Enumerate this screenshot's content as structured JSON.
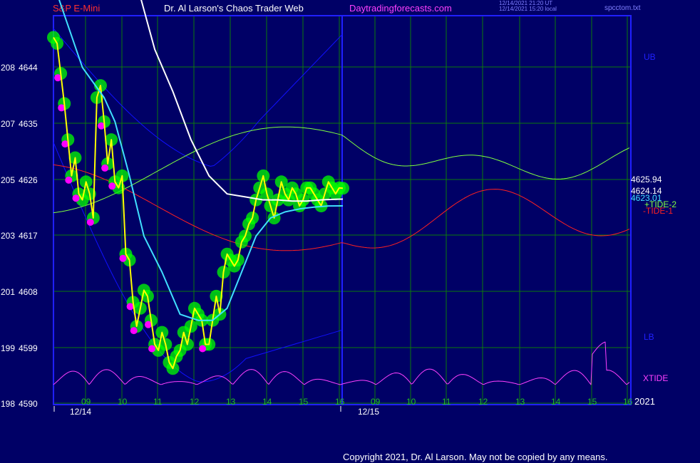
{
  "header": {
    "instrument": "S&P E-Mini",
    "title": "Dr. Al Larson's Chaos Trader Web",
    "site": "Daytradingforecasts.com",
    "timestamp_1": "12/14/2021 21:20 UT",
    "timestamp_2": "12/14/2021 15:20 local",
    "file": "spcctom.txt"
  },
  "copyright": "Copyright 2021, Dr. Al Larson. May not be copied by any means.",
  "colors": {
    "background": "#000066",
    "grid": "#0c7a0c",
    "frame": "#2020ff",
    "price": "#ffff00",
    "price_dots": "#00ff00",
    "extreme_dots": "#ff00ff",
    "average_cyan": "#40e0ff",
    "average_white": "#ffffff",
    "tide_plus": "#80ff40",
    "tide_minus": "#ff2020",
    "xtide": "#ff40ff",
    "bands": "#1010ff"
  },
  "chart_data": {
    "type": "line",
    "y_axis": {
      "ticks": [
        {
          "cycle": "198",
          "price": "4590"
        },
        {
          "cycle": "199",
          "price": "4599"
        },
        {
          "cycle": "201",
          "price": "4608"
        },
        {
          "cycle": "203",
          "price": "4617"
        },
        {
          "cycle": "205",
          "price": "4626"
        },
        {
          "cycle": "207",
          "price": "4635"
        },
        {
          "cycle": "208",
          "price": "4644"
        }
      ],
      "ylim": [
        4590,
        4652
      ]
    },
    "x_axis": {
      "hour_ticks": [
        "09",
        "10",
        "11",
        "12",
        "13",
        "14",
        "15",
        "16",
        "09",
        "10",
        "11",
        "12",
        "13",
        "14",
        "15",
        "16"
      ],
      "date_labels": [
        "12/14",
        "12/15"
      ],
      "year": "2021"
    },
    "value_labels": [
      "4625.94",
      "4624.14",
      "4623.01"
    ],
    "curve_labels": {
      "upper_band": "UB",
      "lower_band": "LB",
      "tide_plus": "+TIDE-2",
      "tide_minus": "-TIDE-1",
      "xtide": "XTIDE"
    },
    "series": [
      {
        "key": "price",
        "x": [
          0,
          0.1,
          0.2,
          0.3,
          0.4,
          0.5,
          0.6,
          0.7,
          0.8,
          0.9,
          1.0,
          1.1,
          1.2,
          1.3,
          1.4,
          1.5,
          1.6,
          1.7,
          1.8,
          1.9,
          2.0,
          2.1,
          2.2,
          2.3,
          2.4,
          2.5,
          2.6,
          2.7,
          2.8,
          2.9,
          3.0,
          3.1,
          3.2,
          3.3,
          3.4,
          3.5,
          3.6,
          3.7,
          3.8,
          3.9,
          4.0,
          4.1,
          4.2,
          4.3,
          4.4,
          4.5,
          4.6,
          4.7,
          4.8,
          4.9,
          5.0,
          5.1,
          5.2,
          5.3,
          5.4,
          5.5,
          5.6,
          5.7,
          5.8,
          5.9,
          6.0,
          6.1,
          6.2,
          6.3,
          6.4,
          6.5,
          6.6,
          6.7,
          6.8,
          6.9,
          7.0,
          7.1,
          7.2,
          7.3,
          7.4,
          7.5,
          7.6,
          7.7,
          7.8,
          7.9,
          8.0
        ],
        "values": [
          4651,
          4650,
          4645,
          4640,
          4634,
          4628,
          4631,
          4625,
          4624,
          4627,
          4625,
          4621,
          4641,
          4643,
          4637,
          4630,
          4634,
          4627,
          4626,
          4628,
          4615,
          4614,
          4607,
          4603,
          4606,
          4609,
          4608,
          4604,
          4600,
          4599,
          4602,
          4600,
          4597,
          4596,
          4598,
          4599,
          4602,
          4600,
          4603,
          4606,
          4605,
          4604,
          4600,
          4600,
          4604,
          4608,
          4605,
          4612,
          4615,
          4614,
          4613,
          4614,
          4617,
          4618,
          4620,
          4621,
          4624,
          4626,
          4628,
          4625,
          4623,
          4621,
          4624,
          4627,
          4625,
          4624,
          4626,
          4625,
          4623,
          4624,
          4626,
          4626,
          4625,
          4624,
          4623,
          4625,
          4627,
          4626,
          4625,
          4626,
          4625.94
        ]
      },
      {
        "key": "average_cyan",
        "x": [
          0,
          0.8,
          1.4,
          1.7,
          2.1,
          2.5,
          3.0,
          3.5,
          4.0,
          4.4,
          4.8,
          5.2,
          5.6,
          6.0,
          6.4,
          6.8,
          7.2,
          7.6,
          8.0
        ],
        "values": [
          4660,
          4646,
          4641,
          4637,
          4628,
          4618,
          4612,
          4605,
          4604,
          4604,
          4606,
          4612,
          4618,
          4621,
          4622,
          4622.5,
          4622.8,
          4623,
          4623.01
        ]
      },
      {
        "key": "average_white",
        "x": [
          2.3,
          2.8,
          3.3,
          3.8,
          4.3,
          4.8,
          5.3,
          5.8,
          6.2,
          6.6,
          7.0,
          7.4,
          7.8,
          8.0
        ],
        "values": [
          4660,
          4649,
          4642,
          4634,
          4628,
          4625,
          4624.5,
          4624,
          4624,
          4623.8,
          4623.8,
          4624,
          4624.1,
          4624.14
        ]
      }
    ]
  }
}
